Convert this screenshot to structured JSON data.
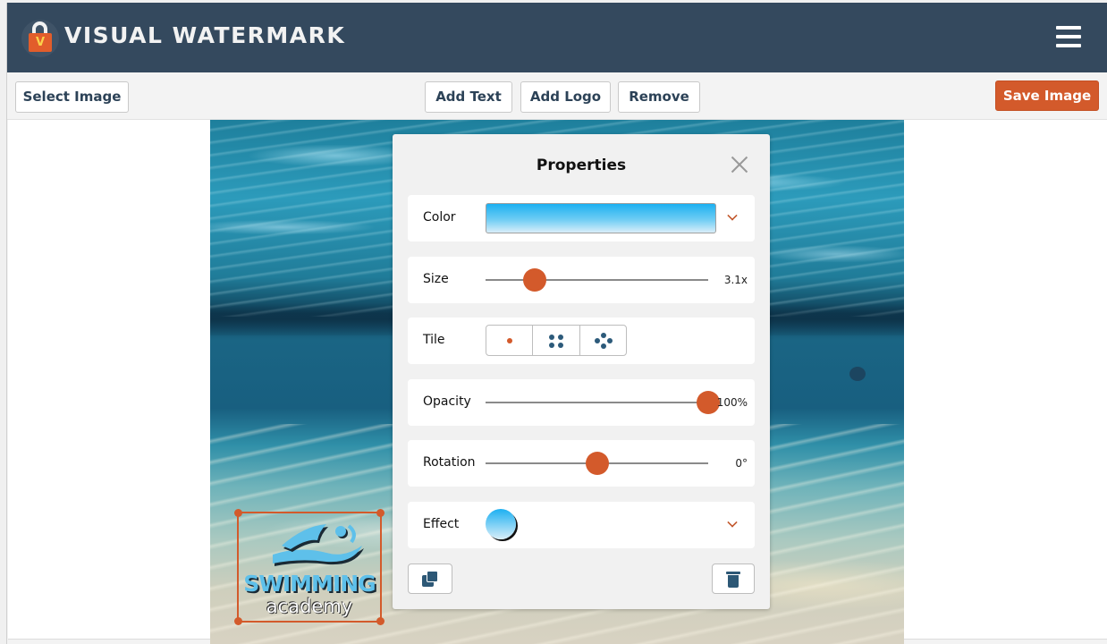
{
  "header": {
    "brand": "VISUAL WATERMARK",
    "logo_icon": "padlock-v-icon",
    "logo_letter": "V",
    "menu_icon": "hamburger-menu-icon"
  },
  "toolbar": {
    "select_image": "Select Image",
    "add_text": "Add Text",
    "add_logo": "Add Logo",
    "remove": "Remove",
    "save_image": "Save Image",
    "accent_color": "#d35a2b"
  },
  "canvas": {
    "image_description": "underwater swimming pool",
    "watermark": {
      "title": "SWIMMING",
      "subtitle": "academy",
      "icon": "swimmer-icon",
      "selected": true
    }
  },
  "properties": {
    "title": "Properties",
    "close_icon": "close-icon",
    "color": {
      "label": "Color",
      "value": "gradient #1cb0f1 → #d9eef9"
    },
    "size": {
      "label": "Size",
      "value_text": "3.1x",
      "fraction": 0.22
    },
    "tile": {
      "label": "Tile",
      "options": [
        "single",
        "grid-4",
        "diamond-5"
      ],
      "selected": "single"
    },
    "opacity": {
      "label": "Opacity",
      "value_text": "100%",
      "fraction": 1.0
    },
    "rotation": {
      "label": "Rotation",
      "value_text": "0°",
      "fraction": 0.5
    },
    "effect": {
      "label": "Effect",
      "value": "drop-shadow"
    },
    "duplicate_icon": "duplicate-icon",
    "delete_icon": "trash-icon"
  }
}
